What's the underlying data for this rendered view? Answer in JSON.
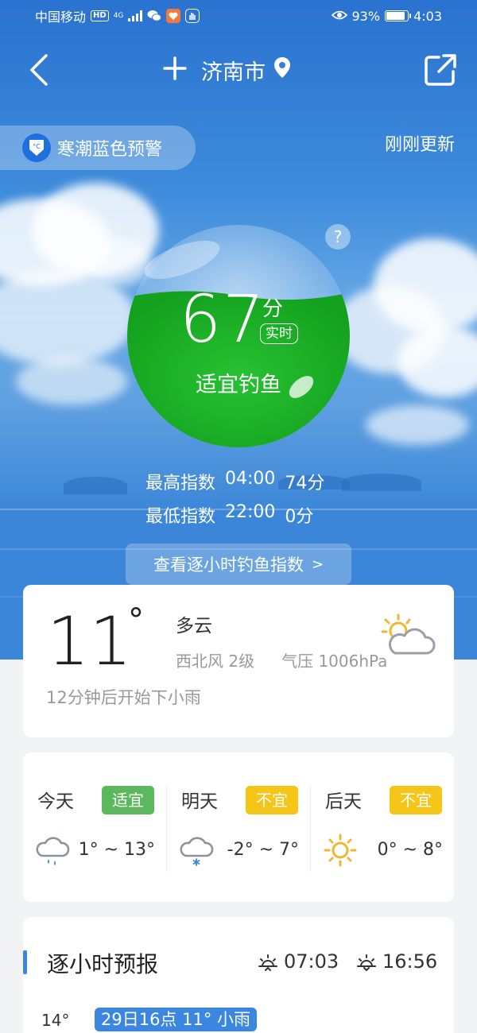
{
  "status_bar": {
    "carrier": "中国移动",
    "hd": "HD",
    "network": "4G",
    "battery_percent": "93%",
    "battery_level": 0.93,
    "time": "4:03"
  },
  "header": {
    "city": "济南市"
  },
  "alert": {
    "label": "寒潮蓝色预警",
    "icon_text": "°C",
    "update_status": "刚刚更新"
  },
  "fishing": {
    "score": "67",
    "score_unit": "分",
    "realtime_label": "实时",
    "level_label": "适宜钓鱼",
    "help_symbol": "?",
    "max_label": "最高指数",
    "max_time": "04:00",
    "max_value": "74分",
    "min_label": "最低指数",
    "min_time": "22:00",
    "min_value": "0分",
    "hourly_button": "查看逐小时钓鱼指数",
    "hourly_arrow": ">",
    "ball_color": "#1fb52a"
  },
  "current": {
    "temperature": "11",
    "degree": "°",
    "condition": "多云",
    "wind": "西北风 2级",
    "pressure": "气压 1006hPa",
    "rain_notice": "12分钟后开始下小雨",
    "icon": "partly-cloudy-icon"
  },
  "forecast": [
    {
      "day": "今天",
      "tag": "适宜",
      "tag_bg": "#5cb85c",
      "tag_color": "#ffffff",
      "icon": "light-rain-icon",
      "range": "1° ~ 13°"
    },
    {
      "day": "明天",
      "tag": "不宜",
      "tag_bg": "#f5c518",
      "tag_color": "#ffffff",
      "icon": "snow-icon",
      "range": "-2° ~ 7°"
    },
    {
      "day": "后天",
      "tag": "不宜",
      "tag_bg": "#f5c518",
      "tag_color": "#ffffff",
      "icon": "sunny-icon",
      "range": "0° ~ 8°"
    }
  ],
  "hourly": {
    "title": "逐小时预报",
    "sunrise": "07:03",
    "sunset": "16:56",
    "first_temp": "14°",
    "tooltip": "29日16点 11° 小雨",
    "accent": "#3a86e0"
  }
}
